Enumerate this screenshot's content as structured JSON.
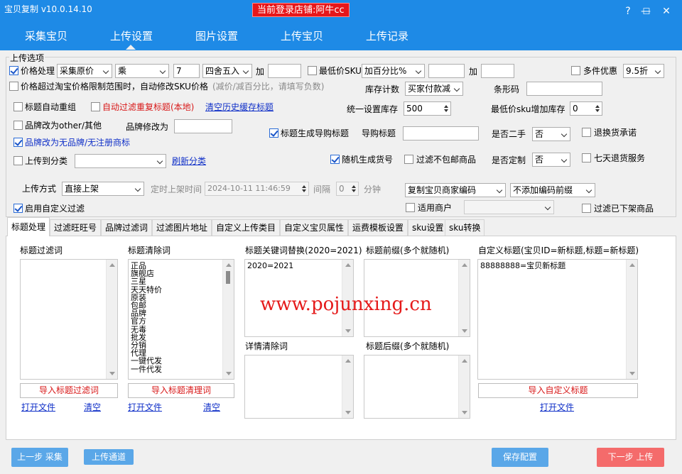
{
  "window": {
    "title": "宝贝复制 v10.0.14.10",
    "login_badge": "当前登录店铺:阿牛cc",
    "help_icon": "?",
    "minimize_icon": "—",
    "maximize_icon": "☐",
    "close_icon": "✕"
  },
  "nav": {
    "items": [
      "采集宝贝",
      "上传设置",
      "图片设置",
      "上传宝贝",
      "上传记录"
    ],
    "active_index": 1
  },
  "upload_options": {
    "legend": "上传选项",
    "price_processing": {
      "label": "价格处理",
      "checked": true,
      "base": "采集原价",
      "operator": "乘",
      "factor": "7",
      "rounding": "四舍五入",
      "add_label": "加",
      "add_value": ""
    },
    "min_price_sku": {
      "label": "最低价SKU",
      "checked": false,
      "mode": "加百分比%",
      "value": "",
      "add_label": "加",
      "add_value": ""
    },
    "multi_discount": {
      "label": "多件优惠",
      "checked": false,
      "value": "9.5折"
    },
    "over_limit": {
      "label": "价格超过淘宝价格限制范围时，自动修改SKU价格",
      "hint": "(减价/减百分比，请填写负数)",
      "checked": false
    },
    "stock_count": {
      "label": "库存计数",
      "value": "买家付款减"
    },
    "barcode": {
      "label": "条形码",
      "value": ""
    },
    "auto_retitle": {
      "label": "标题自动重组",
      "checked": false
    },
    "filter_dup_title": {
      "label": "自动过滤重复标题(本地)",
      "checked": false
    },
    "clear_history_link": "清空历史缓存标题",
    "unify_stock": {
      "label": "统一设置库存",
      "value": "500"
    },
    "min_price_sku_stock": {
      "label": "最低价sku增加库存",
      "value": "0"
    },
    "brand_other": {
      "label": "品牌改为other/其他",
      "checked": false
    },
    "brand_modify": {
      "label": "品牌修改为",
      "value": ""
    },
    "title_guide": {
      "label": "标题生成导购标题",
      "checked": true
    },
    "guide_title": {
      "label": "导购标题",
      "value": ""
    },
    "second_hand": {
      "label": "是否二手",
      "value": "否"
    },
    "return_promise": {
      "label": "退换货承诺",
      "checked": false
    },
    "brand_none": {
      "label": "品牌改为无品牌/无注册商标",
      "checked": true
    },
    "upload_category": {
      "label": "上传到分类",
      "checked": false,
      "value": ""
    },
    "refresh_category_link": "刷新分类",
    "random_sku": {
      "label": "随机生成货号",
      "checked": true
    },
    "filter_no_freeship": {
      "label": "过滤不包邮商品",
      "checked": false
    },
    "customized": {
      "label": "是否定制",
      "value": "否"
    },
    "seven_day_return": {
      "label": "七天退货服务",
      "checked": false
    },
    "upload_mode": {
      "label": "上传方式",
      "value": "直接上架"
    },
    "scheduled_time": {
      "label": "定时上架时间",
      "value": "2024-10-11 11:46:59"
    },
    "interval": {
      "label": "间隔",
      "value": "0",
      "unit": "分钟"
    },
    "merchant_code": {
      "value": "复制宝贝商家编码"
    },
    "code_prefix": {
      "value": "不添加编码前缀"
    },
    "custom_filter": {
      "label": "启用自定义过滤",
      "checked": true
    },
    "merchant_apply": {
      "label": "适用商户",
      "checked": false,
      "value": ""
    },
    "filter_offshelf": {
      "label": "过滤已下架商品",
      "checked": false
    }
  },
  "tabs": [
    "标题处理",
    "过滤旺旺号",
    "品牌过滤词",
    "过滤图片地址",
    "自定义上传类目",
    "自定义宝贝属性",
    "运费模板设置",
    "sku设置",
    "sku转换"
  ],
  "title_tab": {
    "filter_words": {
      "label": "标题过滤词",
      "content": "",
      "import_button": "导入标题过滤词",
      "open_link": "打开文件",
      "clear_link": "清空"
    },
    "clean_words": {
      "label": "标题清除词",
      "items": [
        "正品",
        "旗舰店",
        "三星",
        "天天特价",
        "原装",
        "包邮",
        "品牌",
        "官方",
        "无毒",
        "批发",
        "分销",
        "代理",
        "一键代发",
        "一件代发"
      ],
      "import_button": "导入标题清理词",
      "open_link": "打开文件",
      "clear_link": "清空"
    },
    "keyword_replace": {
      "label": "标题关键词替换(2020=2021)",
      "content": "2020=2021"
    },
    "detail_clean": {
      "label": "详情清除词",
      "content": ""
    },
    "prefix": {
      "label": "标题前缀(多个就随机)",
      "content": ""
    },
    "suffix": {
      "label": "标题后缀(多个就随机)",
      "content": ""
    },
    "custom_title": {
      "label": "自定义标题(宝贝ID=新标题,标题=新标题)",
      "content": "88888888=宝贝新标题",
      "import_button": "导入自定义标题",
      "open_link": "打开文件"
    }
  },
  "watermark": "www.pojunxing.cn",
  "footer": {
    "prev_button": "上一步 采集",
    "channel_button": "上传通道",
    "save_button": "保存配置",
    "next_button": "下一步 上传"
  }
}
